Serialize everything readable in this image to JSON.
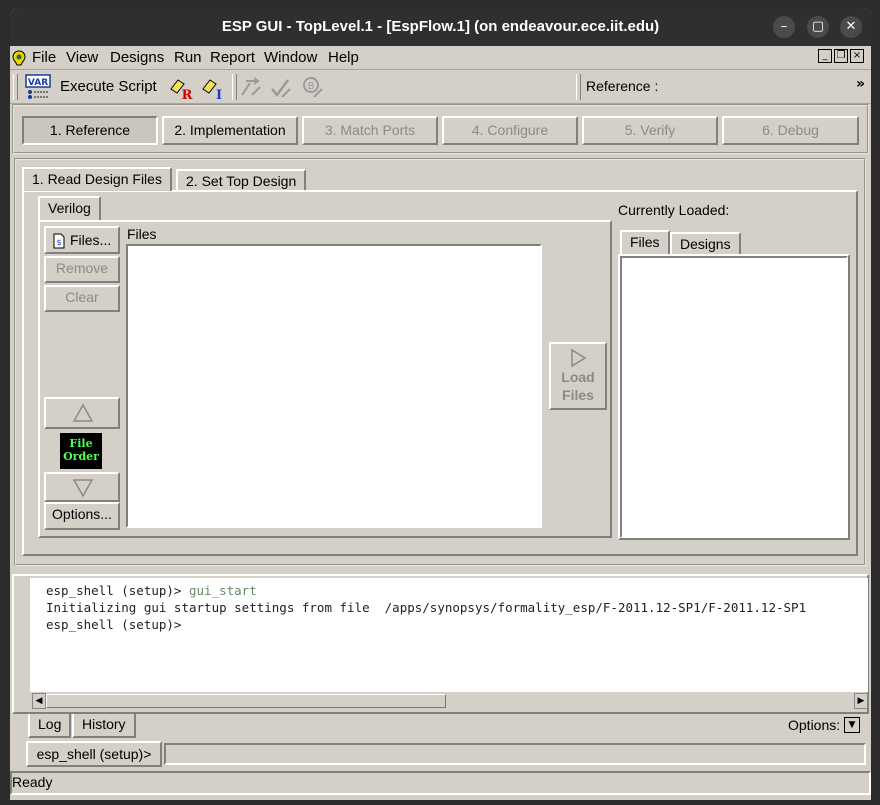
{
  "window": {
    "title": "ESP GUI - TopLevel.1 - [EspFlow.1] (on endeavour.ece.iit.edu)",
    "minimize": "–",
    "maximize": "▢",
    "close": "✕"
  },
  "menubar": {
    "items": [
      "File",
      "View",
      "Designs",
      "Run",
      "Report",
      "Window",
      "Help"
    ],
    "mdi_minimize": "_",
    "mdi_restore": "❐",
    "mdi_close": "×"
  },
  "toolbar": {
    "execute_label": "Execute Script",
    "reference_label": "Reference :",
    "overflow": "»",
    "var_icon_text": "VAR",
    "ref_marker": "R",
    "impl_marker": "I"
  },
  "steps": [
    "1. Reference",
    "2. Implementation",
    "3. Match Ports",
    "4. Configure",
    "5. Verify",
    "6. Debug"
  ],
  "tabs": {
    "read_design_files": "1. Read Design Files",
    "set_top_design": "2. Set Top Design",
    "verilog": "Verilog"
  },
  "file_panel": {
    "files_button": "Files...",
    "remove_button": "Remove",
    "clear_button": "Clear",
    "files_label": "Files",
    "file_order": "File Order",
    "options_button": "Options...",
    "load_files_button": "Load Files"
  },
  "loaded": {
    "label": "Currently Loaded:",
    "tab_files": "Files",
    "tab_designs": "Designs"
  },
  "console": {
    "lines": [
      {
        "prompt": "esp_shell (setup)> ",
        "cmd": "gui_start"
      },
      {
        "prompt": "Initializing gui startup settings from file  /apps/synopsys/formality_esp/F-2011.12-SP1/F-2011.12-SP1",
        "cmd": ""
      },
      {
        "prompt": "esp_shell (setup)>",
        "cmd": ""
      }
    ],
    "tab_log": "Log",
    "tab_history": "History",
    "options_label": "Options:",
    "prompt_label": "esp_shell (setup)>",
    "input_value": ""
  },
  "status": {
    "text": "Ready"
  },
  "colors": {
    "panel": "#d4d0c8",
    "titlebar": "#2f2f2f",
    "file_order_text": "#4cff4c"
  }
}
